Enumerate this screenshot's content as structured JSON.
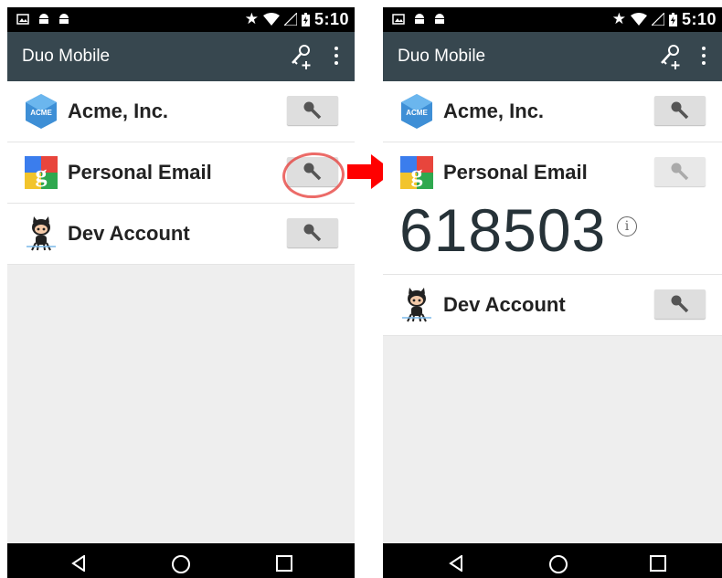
{
  "status_bar": {
    "time": "5:10"
  },
  "app": {
    "title": "Duo Mobile"
  },
  "accounts": [
    {
      "name": "Acme, Inc.",
      "icon": "acme-logo-icon"
    },
    {
      "name": "Personal Email",
      "icon": "google-logo-icon"
    },
    {
      "name": "Dev Account",
      "icon": "github-octocat-icon"
    }
  ],
  "passcode": {
    "value": "618503",
    "info_symbol": "i"
  },
  "colors": {
    "app_bar": "#37474f",
    "background": "#eeeeee",
    "highlight": "#e53935",
    "arrow": "#ff0000"
  }
}
